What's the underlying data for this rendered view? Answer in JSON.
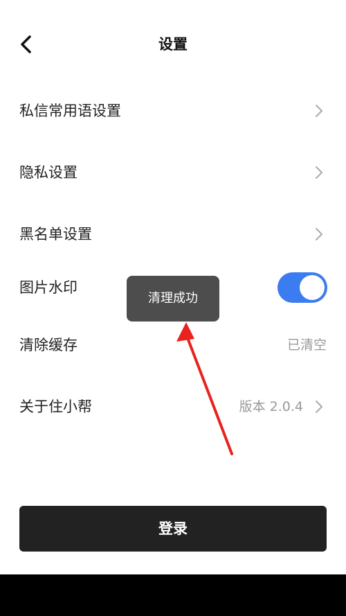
{
  "header": {
    "title": "设置",
    "back_icon": "chevron-left-icon"
  },
  "settings": {
    "private_message_phrases": {
      "label": "私信常用语设置",
      "icon": "chevron-right-icon"
    },
    "privacy": {
      "label": "隐私设置",
      "icon": "chevron-right-icon"
    },
    "blacklist": {
      "label": "黑名单设置",
      "icon": "chevron-right-icon"
    },
    "image_watermark": {
      "label": "图片水印",
      "enabled": true
    },
    "clear_cache": {
      "label": "清除缓存",
      "value": "已清空"
    },
    "about": {
      "label": "关于住小帮",
      "value": "版本 2.0.4",
      "icon": "chevron-right-icon"
    }
  },
  "toast": {
    "text": "清理成功"
  },
  "login_button": {
    "label": "登录"
  },
  "colors": {
    "accent": "#3b7cf0",
    "toast_bg": "#4d4d4d",
    "button_bg": "#222222",
    "annotation_arrow": "#e8221d"
  }
}
